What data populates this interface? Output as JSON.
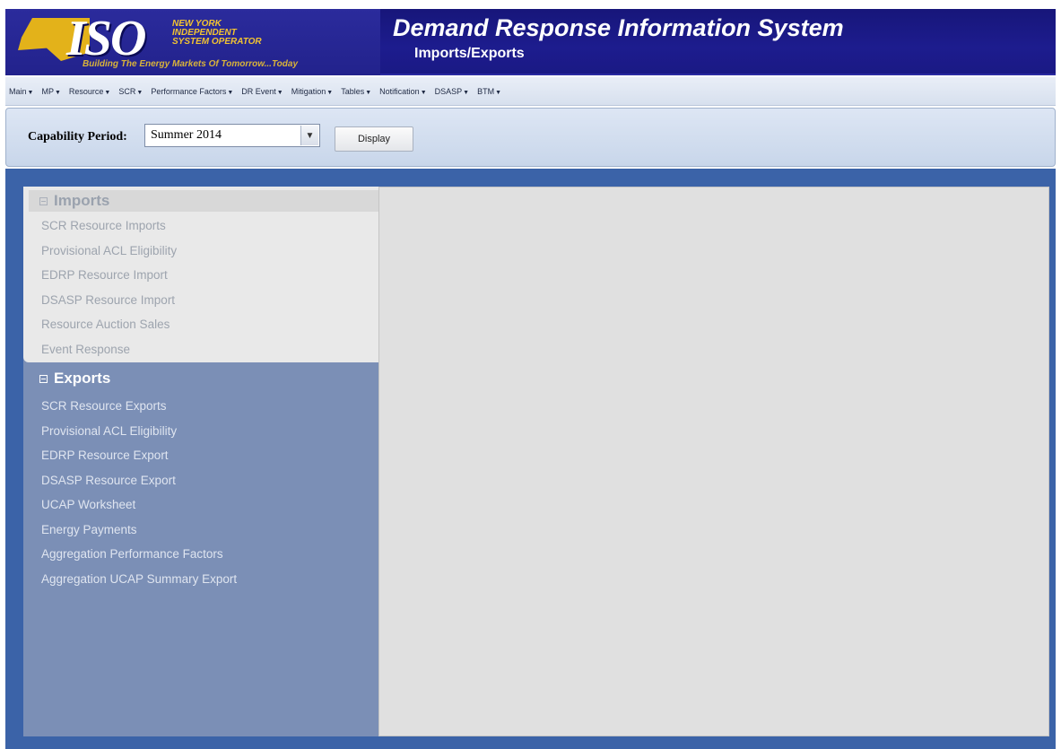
{
  "header": {
    "logo": {
      "mark": "ISO",
      "org_lines": [
        "New York",
        "Independent",
        "System Operator"
      ],
      "tagline": "Building The Energy Markets Of Tomorrow...Today"
    },
    "app_title": "Demand Response Information System",
    "page_subtitle": "Imports/Exports"
  },
  "menu": {
    "items": [
      {
        "label": "Main",
        "icon": "caret-down"
      },
      {
        "label": "MP",
        "icon": "caret-down"
      },
      {
        "label": "Resource",
        "icon": "caret-down"
      },
      {
        "label": "SCR",
        "icon": "caret-down"
      },
      {
        "label": "Performance Factors",
        "icon": "caret-down"
      },
      {
        "label": "DR Event",
        "icon": "caret-down"
      },
      {
        "label": "Mitigation",
        "icon": "caret-down"
      },
      {
        "label": "Tables",
        "icon": "caret-down"
      },
      {
        "label": "Notification",
        "icon": "caret-down"
      },
      {
        "label": "DSASP",
        "icon": "caret-down"
      },
      {
        "label": "BTM",
        "icon": "caret-down"
      }
    ]
  },
  "filter": {
    "label": "Capability Period:",
    "selected": "Summer 2014",
    "button_label": "Display"
  },
  "sidebar": {
    "imports": {
      "title": "Imports",
      "items": [
        "SCR Resource Imports",
        "Provisional ACL Eligibility",
        "EDRP Resource Import",
        "DSASP Resource Import",
        "Resource Auction Sales",
        "Event Response"
      ]
    },
    "exports": {
      "title": "Exports",
      "items": [
        "SCR Resource Exports",
        "Provisional ACL Eligibility",
        "EDRP Resource Export",
        "DSASP Resource Export",
        "UCAP Worksheet",
        "Energy Payments",
        "Aggregation Performance Factors",
        "Aggregation UCAP Summary Export"
      ]
    }
  },
  "colors": {
    "header_bg": "#1d1c8e",
    "logo_gold": "#e3b21a",
    "main_bg": "#3b63a8",
    "sidebar_bg": "#7b8fb6",
    "content_bg": "#e0e0e0"
  }
}
